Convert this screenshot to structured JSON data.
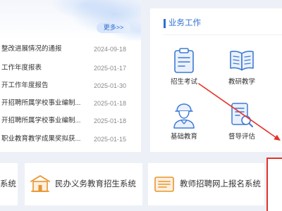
{
  "news": {
    "more_label": "更多>>",
    "items": [
      {
        "title": "整改进展情况的通报",
        "date": "2024-09-18"
      },
      {
        "title": "工作年度报表",
        "date": "2025-01-17"
      },
      {
        "title": "开工作年度报告",
        "date": "2025-01-30"
      },
      {
        "title": "开招聘所属学校事业编制...",
        "date": "2025-01-18"
      },
      {
        "title": "开招聘所属学校事业编制...",
        "date": "2025-01-18"
      },
      {
        "title": "职业教育教学成果奖拟获...",
        "date": "2025-01-15"
      }
    ]
  },
  "business": {
    "title": "业务工作",
    "items": [
      {
        "label": "招生考试",
        "icon": "clipboard-icon"
      },
      {
        "label": "教研教学",
        "icon": "open-book-icon"
      },
      {
        "label": "基础教育",
        "icon": "student-icon"
      },
      {
        "label": "督导评估",
        "icon": "document-magnifier-icon"
      }
    ]
  },
  "systems": [
    {
      "label": "系统"
    },
    {
      "label": "民办义务教育招生系统",
      "icon": "school-building-icon"
    },
    {
      "label": "教师招聘网上报名系统",
      "icon": "form-list-icon"
    }
  ],
  "colors": {
    "accent_blue": "#2e6fcf",
    "icon_blue": "#3f7bd4",
    "icon_orange": "#e8952f",
    "annotation_red": "#e5322a",
    "page_background": "#edf1f7"
  }
}
